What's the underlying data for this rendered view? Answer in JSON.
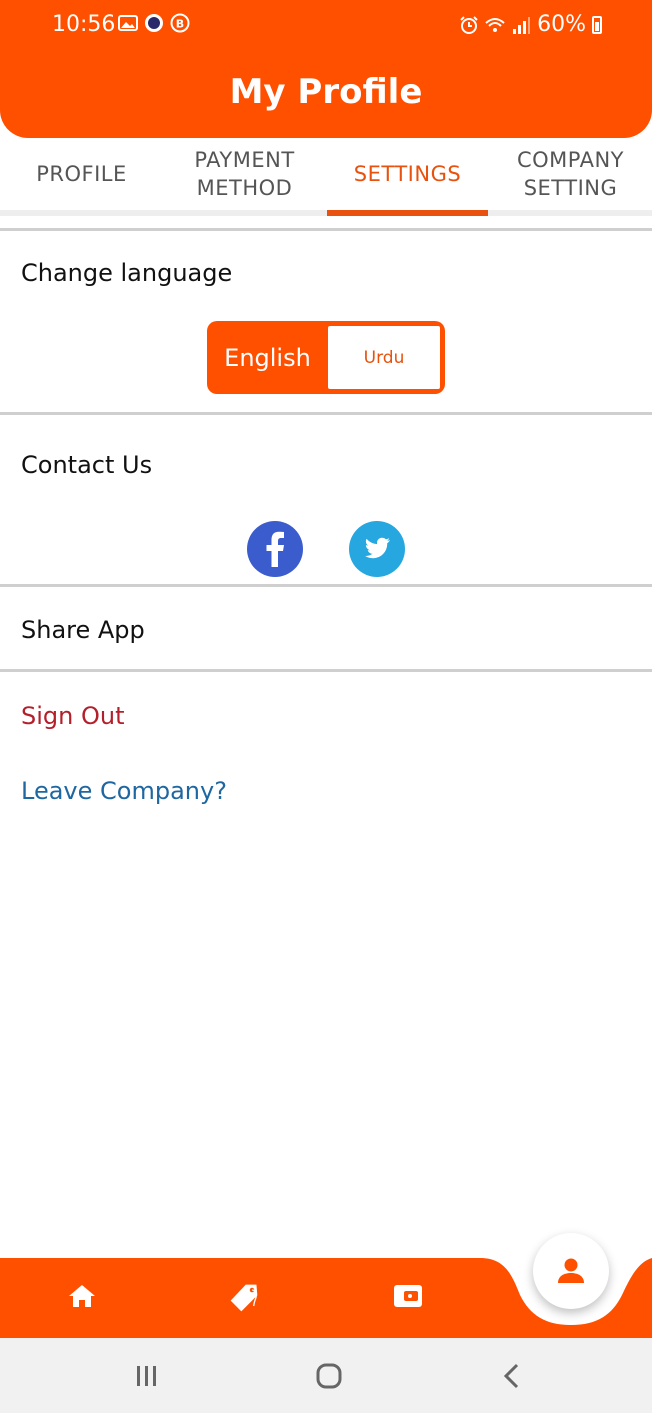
{
  "status_bar": {
    "time": "10:56",
    "battery": "60%"
  },
  "header": {
    "title": "My Profile"
  },
  "tabs": [
    {
      "label": "PROFILE",
      "active": false
    },
    {
      "label": "PAYMENT\nMETHOD",
      "active": false
    },
    {
      "label": "SETTINGS",
      "active": true
    },
    {
      "label": "COMPANY\nSETTING",
      "active": false
    }
  ],
  "settings": {
    "change_language_label": "Change language",
    "language_options": [
      "English",
      "Urdu"
    ],
    "selected_language": "English",
    "contact_us_label": "Contact Us",
    "social_icons": [
      "facebook-icon",
      "twitter-icon"
    ],
    "share_app_label": "Share App",
    "sign_out_label": "Sign Out",
    "leave_company_label": "Leave Company?"
  },
  "bottom_nav": {
    "items": [
      "home-icon",
      "tag-icon",
      "wallet-icon",
      "profile-icon"
    ],
    "active": "profile-icon"
  },
  "colors": {
    "brand": "#FF5000",
    "active_tab": "#E8520E",
    "sign_out": "#B3202C",
    "leave_company": "#1E67A0",
    "facebook": "#3B5CCC",
    "twitter": "#27A7E0"
  }
}
